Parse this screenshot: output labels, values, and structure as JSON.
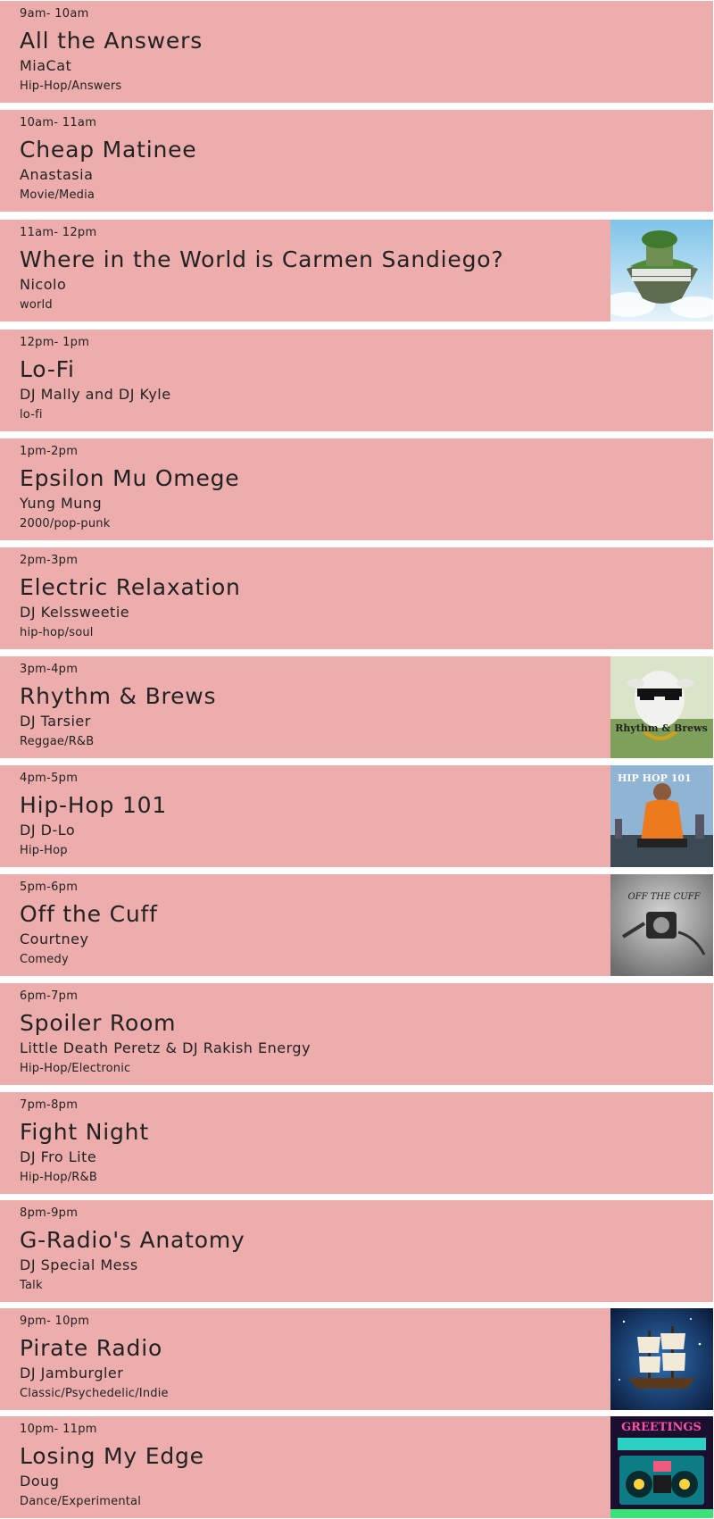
{
  "shows": [
    {
      "time": "9am- 10am",
      "title": "All the Answers",
      "host": "MiaCat",
      "genre": "Hip-Hop/Answers"
    },
    {
      "time": "10am- 11am",
      "title": "Cheap Matinee",
      "host": "Anastasia",
      "genre": "Movie/Media"
    },
    {
      "time": "11am- 12pm",
      "title": "Where in the World is Carmen Sandiego?",
      "host": "Nicolo",
      "genre": "world",
      "image": "floating-island-icon"
    },
    {
      "time": "12pm- 1pm",
      "title": "Lo-Fi",
      "host": "DJ Mally and DJ Kyle",
      "genre": "lo-fi"
    },
    {
      "time": "1pm-2pm",
      "title": "Epsilon Mu Omege",
      "host": "Yung Mung",
      "genre": "2000/pop-punk"
    },
    {
      "time": "2pm-3pm",
      "title": "Electric Relaxation",
      "host": "DJ Kelssweetie",
      "genre": "hip-hop/soul"
    },
    {
      "time": "3pm-4pm",
      "title": "Rhythm & Brews",
      "host": "DJ Tarsier",
      "genre": "Reggae/R&B",
      "image": "goat-with-sunglasses-icon",
      "image_caption": "Rhythm & Brews"
    },
    {
      "time": "4pm-5pm",
      "title": "Hip-Hop 101",
      "host": "DJ D-Lo",
      "genre": "Hip-Hop",
      "image": "album-cover-icon",
      "image_caption": "HIP HOP 101"
    },
    {
      "time": "5pm-6pm",
      "title": "Off the Cuff",
      "host": "Courtney",
      "genre": "Comedy",
      "image": "microphone-grayscale-icon",
      "image_caption": "OFF THE CUFF"
    },
    {
      "time": "6pm-7pm",
      "title": "Spoiler Room",
      "host": "Little Death Peretz & DJ Rakish Energy",
      "genre": "Hip-Hop/Electronic"
    },
    {
      "time": "7pm-8pm",
      "title": "Fight Night",
      "host": "DJ Fro Lite",
      "genre": "Hip-Hop/R&B"
    },
    {
      "time": "8pm-9pm",
      "title": "G-Radio's Anatomy",
      "host": "DJ Special Mess",
      "genre": "Talk"
    },
    {
      "time": "9pm- 10pm",
      "title": "Pirate Radio",
      "host": "DJ Jamburgler",
      "genre": "Classic/Psychedelic/Indie",
      "image": "sailing-ship-icon"
    },
    {
      "time": "10pm- 11pm",
      "title": "Losing My Edge",
      "host": "Doug",
      "genre": "Dance/Experimental",
      "image": "retro-boombox-icon",
      "image_caption": "GREETINGS"
    }
  ],
  "colors": {
    "row_background": "#edadad",
    "separator": "#ffffff",
    "text": "#222222"
  }
}
